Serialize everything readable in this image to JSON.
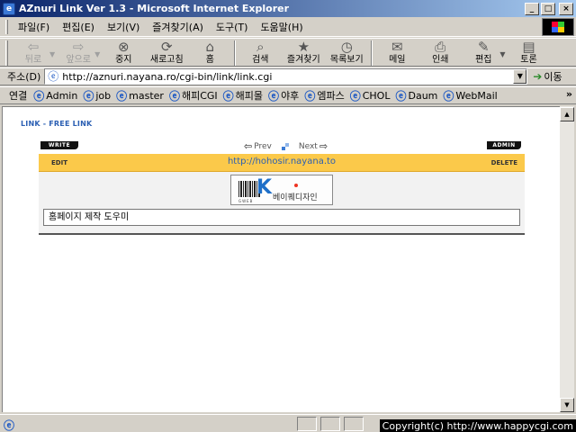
{
  "window": {
    "title": "AZnuri Link Ver 1.3 - Microsoft Internet Explorer",
    "controls": {
      "minimize": "_",
      "maximize": "□",
      "close": "×"
    }
  },
  "menubar": [
    "파일(F)",
    "편집(E)",
    "보기(V)",
    "즐겨찾기(A)",
    "도구(T)",
    "도움말(H)"
  ],
  "toolbar": {
    "back": {
      "label": "뒤로",
      "icon": "back-arrow-icon",
      "glyph": "⇦"
    },
    "forward": {
      "label": "앞으로",
      "icon": "forward-arrow-icon",
      "glyph": "⇨"
    },
    "stop": {
      "label": "중지",
      "icon": "stop-icon",
      "glyph": "⊗"
    },
    "refresh": {
      "label": "새로고침",
      "icon": "refresh-icon",
      "glyph": "⟳"
    },
    "home": {
      "label": "홈",
      "icon": "home-icon",
      "glyph": "⌂"
    },
    "search": {
      "label": "검색",
      "icon": "search-icon",
      "glyph": "⌕"
    },
    "favorites": {
      "label": "즐겨찾기",
      "icon": "favorites-icon",
      "glyph": "★"
    },
    "history": {
      "label": "목록보기",
      "icon": "history-icon",
      "glyph": "◷"
    },
    "mail": {
      "label": "메일",
      "icon": "mail-icon",
      "glyph": "✉"
    },
    "print": {
      "label": "인쇄",
      "icon": "print-icon",
      "glyph": "⎙"
    },
    "edit": {
      "label": "편집",
      "icon": "edit-icon",
      "glyph": "✎"
    },
    "discuss": {
      "label": "토론",
      "icon": "discuss-icon",
      "glyph": "▤"
    }
  },
  "address": {
    "label": "주소(D)",
    "url": "http://aznuri.nayana.ro/cgi-bin/link/link.cgi",
    "go_label": "이동"
  },
  "links": {
    "label": "연결",
    "items": [
      "Admin",
      "job",
      "master",
      "해피CGI",
      "해피몰",
      "야후",
      "엠파스",
      "CHOL",
      "Daum",
      "WebMail"
    ],
    "more": "»"
  },
  "page": {
    "category": "LINK - FREE LINK",
    "write_label": "WRITE",
    "admin_label": "ADMIN",
    "prev_label": "Prev",
    "next_label": "Next",
    "edit_label": "EDIT",
    "delete_label": "DELETE",
    "link_url": "http://hohosir.nayana.to",
    "banner": {
      "name": "베이퀘디자인",
      "subtext": "GWEB"
    },
    "description": "홈페이지 제작 도우미"
  },
  "statusbar": {
    "overlay_text": "Copyright(c) http://www.happycgi.com"
  }
}
